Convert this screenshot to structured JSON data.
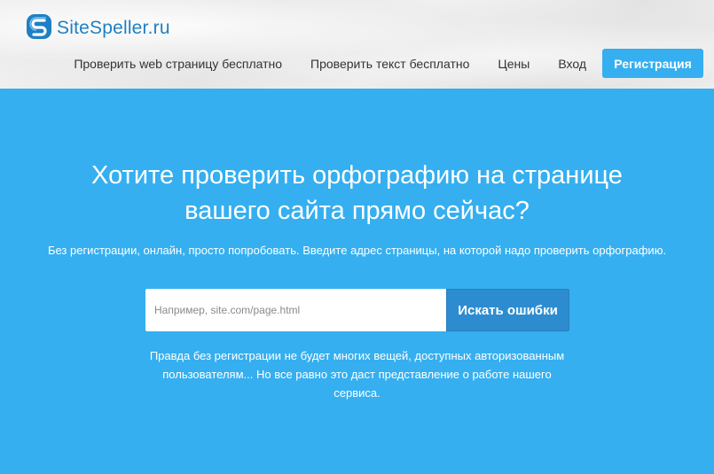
{
  "brand": {
    "name": "SiteSpeller.ru",
    "color": "#1e7fc4"
  },
  "nav": {
    "items": [
      "Проверить web страницу бесплатно",
      "Проверить текст бесплатно",
      "Цены",
      "Вход"
    ],
    "register_label": "Регистрация"
  },
  "hero": {
    "title_line1": "Хотите проверить орфографию на странице",
    "title_line2": "вашего сайта прямо сейчас?",
    "subtitle": "Без регистрации, онлайн, просто попробовать. Введите адрес страницы, на которой надо проверить орфографию.",
    "search_placeholder": "Например, site.com/page.html",
    "search_value": "",
    "search_button": "Искать ошибки",
    "note": "Правда без регистрации не будет многих вещей, доступных авторизованным пользователям... Но все равно это даст представление о работе нашего сервиса."
  },
  "colors": {
    "accent": "#35aff0",
    "button_dark": "#2d8cd0"
  }
}
